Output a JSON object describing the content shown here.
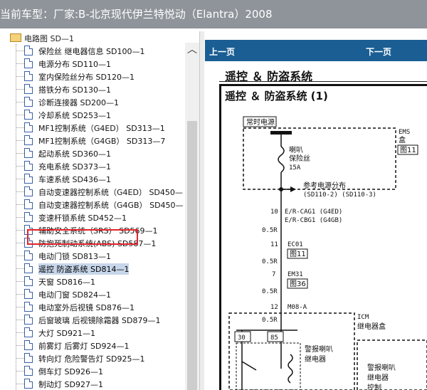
{
  "window": {
    "title": "当前车型：厂家:B-北京现代伊兰特悦动（Elantra）2008"
  },
  "tree": {
    "root_label": "电路图 SD—1",
    "items": [
      {
        "label": "保险丝 继电器信息 SD100—1"
      },
      {
        "label": "电源分布 SD110—1"
      },
      {
        "label": "室内保险丝分布 SD120—1"
      },
      {
        "label": "搭铁分布 SD130—1"
      },
      {
        "label": "诊断连接器 SD200—1"
      },
      {
        "label": "冷却系统 SD253—1"
      },
      {
        "label": "MF1控制系统（G4ED） SD313—1"
      },
      {
        "label": "MF1控制系统（G4GB） SD313—7"
      },
      {
        "label": "起动系统 SD360—1"
      },
      {
        "label": "充电系统 SD373—1"
      },
      {
        "label": "车速系统 SD436—1"
      },
      {
        "label": "自动变速器控制系统（G4ED） SD450—"
      },
      {
        "label": "自动变速器控制系统（G4GB） SD450—"
      },
      {
        "label": "变速杆锁系统 SD452—1"
      },
      {
        "label": "辅助安全系统（SRS） SD569—1"
      },
      {
        "label": "防抱死制动系统(ABS) SD587—1"
      },
      {
        "label": "电动门锁 SD813—1"
      },
      {
        "label": "遥控 防盗系统 SD814—1",
        "selected": true
      },
      {
        "label": "天窗 SD816—1"
      },
      {
        "label": "电动门窗 SD824—1"
      },
      {
        "label": "电动室外后视镜 SD876—1"
      },
      {
        "label": "后窗玻璃 后视镜除霜器 SD879—1"
      },
      {
        "label": "大灯 SD921—1"
      },
      {
        "label": "前雾灯 后雾灯 SD924—1"
      },
      {
        "label": "转向灯 危险警告灯 SD925—1"
      },
      {
        "label": "倒车灯 SD926—1"
      },
      {
        "label": "制动灯 SD927—1"
      }
    ]
  },
  "nav": {
    "prev_label": "上一页",
    "next_label": "下一页"
  },
  "document": {
    "title": "遥控 ＆ 防盗系统",
    "subtitle": "遥控 ＆ 防盗系统 (1)",
    "diagram": {
      "power_label": "常时电源",
      "fuse_label_1": "喇叭",
      "fuse_label_2": "保险丝",
      "fuse_rating": "15A",
      "ref_label": "参考电源分布",
      "ref_pages": "(SD110-2) (SD110-3)",
      "ems_label": "EMS",
      "ems_box": "盒",
      "fig_1": "图11",
      "wire_1_num": "10",
      "wire_1_a": "E/R-CAG1 (G4ED)",
      "wire_1_b": "E/R-CBG1 (G4GB)",
      "gauge_1": "0.5R",
      "ec_num": "11",
      "ec_label": "EC01",
      "fig_2": "图11",
      "gauge_2": "0.5R",
      "em_num": "7",
      "em_label": "EM31",
      "fig_3": "图36",
      "gauge_3": "0.5R",
      "m_num": "12",
      "m_label": "M08-A",
      "gauge_4": "0.5R",
      "icm_label": "ICM",
      "icm_box": "继电器盒",
      "pin_a": "30",
      "pin_b": "85",
      "relay_label_1": "警报喇叭",
      "relay_label_2": "继电器",
      "relay2_label_1": "警报喇叭",
      "relay2_label_2": "继电器",
      "relay2_label_3": "控制"
    }
  },
  "colors": {
    "nav_bg": "#1a5e93",
    "selection_box": "#e0242a",
    "title_bg": "#8e949a"
  }
}
